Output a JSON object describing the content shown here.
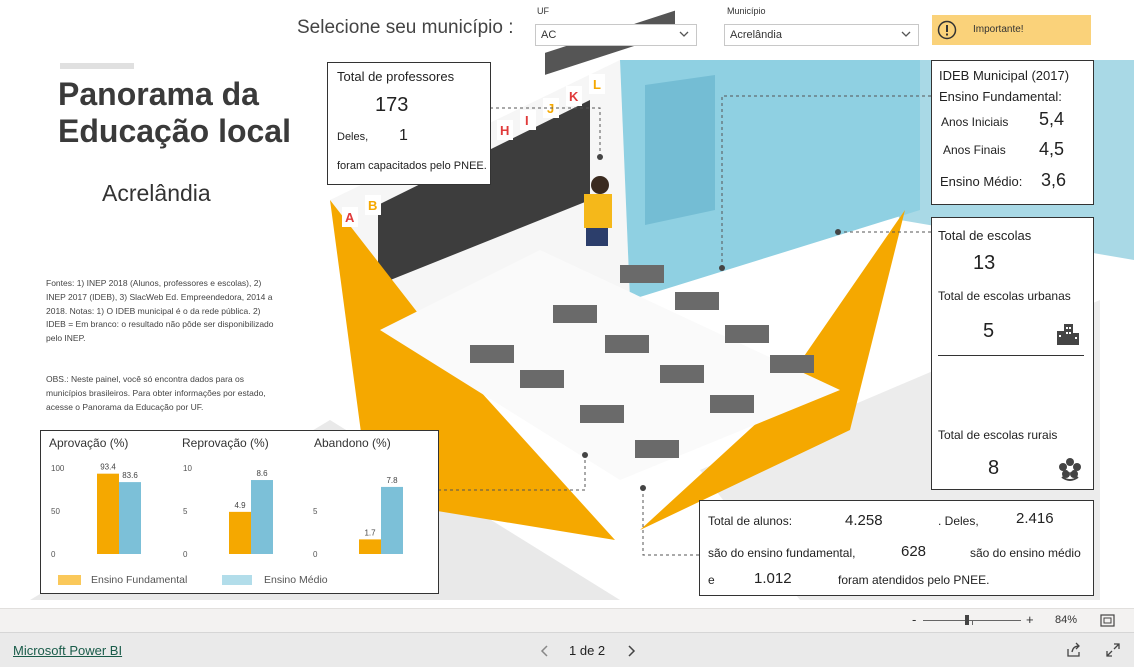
{
  "header": {
    "select_prompt": "Selecione seu município :",
    "uf_label": "UF",
    "uf_value": "AC",
    "municipio_label": "Município",
    "municipio_value": "Acrelândia",
    "important_label": "Importante!"
  },
  "title": {
    "line1": "Panorama da",
    "line2": "Educação local",
    "municipality": "Acrelândia"
  },
  "notes": {
    "sources": "Fontes: 1) INEP 2018 (Alunos, professores e escolas), 2) INEP 2017 (IDEB), 3) SlacWeb Ed. Empreendedora, 2014 a 2018. Notas: 1) O IDEB municipal é o da rede pública. 2) IDEB = Em branco: o resultado não pôde ser disponibilizado pelo INEP.",
    "obs": "OBS.: Neste painel, você só encontra dados para os municípios brasileiros. Para obter informações por estado, acesse o Panorama da Educação por UF."
  },
  "teachers": {
    "title": "Total de professores",
    "total": "173",
    "deles_label": "Deles,",
    "trained": "1",
    "trained_text": "foram capacitados pelo PNEE."
  },
  "ideb": {
    "title_line1": "IDEB Municipal (2017)",
    "title_line2": "Ensino Fundamental:",
    "anos_iniciais_label": "Anos Iniciais",
    "anos_iniciais_value": "5,4",
    "anos_finais_label": "Anos Finais",
    "anos_finais_value": "4,5",
    "ensino_medio_label": "Ensino Médio:",
    "ensino_medio_value": "3,6"
  },
  "schools": {
    "total_label": "Total de escolas",
    "total_value": "13",
    "urban_label": "Total de escolas urbanas",
    "urban_value": "5",
    "rural_label": "Total de escolas rurais",
    "rural_value": "8"
  },
  "students": {
    "total_label": "Total de alunos:",
    "total_value": "4.258",
    "deles_label": ". Deles,",
    "fundamental_value": "2.416",
    "fundamental_text": "são do ensino fundamental,",
    "medio_value": "628",
    "medio_text": "são do ensino médio",
    "e_label": "e",
    "pnee_value": "1.012",
    "pnee_text": "foram atendidos pelo PNEE."
  },
  "colors": {
    "fundamental": "#F5A800",
    "medio": "#7CC0D8",
    "important_bg": "#FAD27A",
    "accent_blue": "#6FC3D8",
    "dark_text": "#3a3a3a"
  },
  "chart_data": [
    {
      "type": "bar",
      "title": "Aprovação (%)",
      "categories": [
        ""
      ],
      "series": [
        {
          "name": "Ensino Fundamental",
          "values": [
            93.4
          ]
        },
        {
          "name": "Ensino Médio",
          "values": [
            83.6
          ]
        }
      ],
      "yticks": [
        "0",
        "50",
        "100"
      ],
      "ylim": [
        0,
        100
      ],
      "data_labels": [
        "93.4",
        "83.6"
      ]
    },
    {
      "type": "bar",
      "title": "Reprovação (%)",
      "categories": [
        ""
      ],
      "series": [
        {
          "name": "Ensino Fundamental",
          "values": [
            4.9
          ]
        },
        {
          "name": "Ensino Médio",
          "values": [
            8.6
          ]
        }
      ],
      "yticks": [
        "0",
        "5",
        "10"
      ],
      "ylim": [
        0,
        10
      ],
      "data_labels": [
        "4.9",
        "8.6"
      ]
    },
    {
      "type": "bar",
      "title": "Abandono (%)",
      "categories": [
        ""
      ],
      "series": [
        {
          "name": "Ensino Fundamental",
          "values": [
            1.7
          ]
        },
        {
          "name": "Ensino Médio",
          "values": [
            7.8
          ]
        }
      ],
      "yticks": [
        "0",
        "5"
      ],
      "ylim": [
        0,
        10
      ],
      "data_labels": [
        "1.7",
        "7.8"
      ]
    }
  ],
  "legend": {
    "fundamental": "Ensino Fundamental",
    "medio": "Ensino Médio"
  },
  "zoom": {
    "minus": "-",
    "plus": "+",
    "level": "84%",
    "fraction": 0.45
  },
  "footer": {
    "brand": "Microsoft Power BI",
    "page": "1 de 2"
  }
}
